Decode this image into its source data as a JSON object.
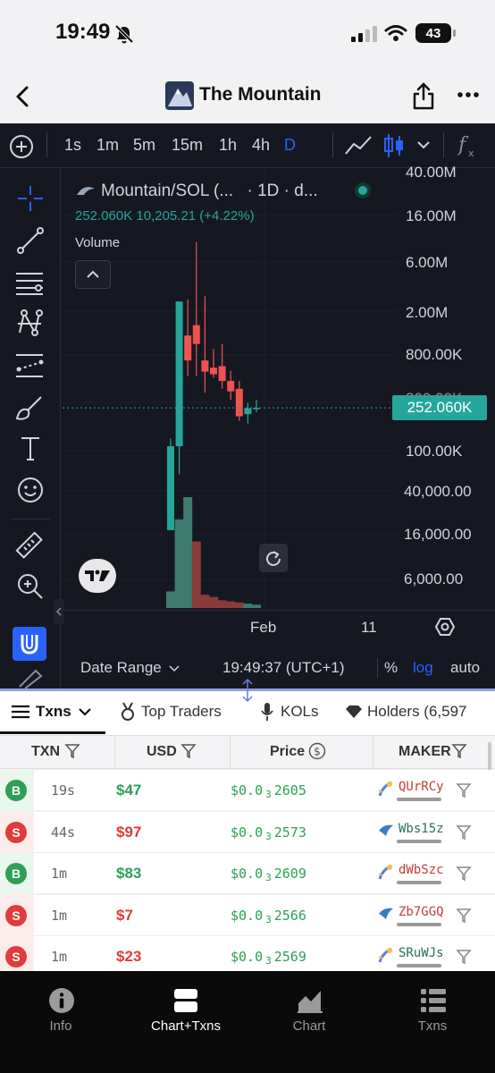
{
  "status_bar": {
    "time": "19:49",
    "battery": "43"
  },
  "header": {
    "title": "The Mountain"
  },
  "chart_toolbar": {
    "intervals": [
      "1s",
      "1m",
      "5m",
      "15m",
      "1h",
      "4h",
      "D"
    ],
    "active_interval": "D"
  },
  "chart_legend": {
    "symbol": "Mountain/SOL (...",
    "timeframe": "· 1D · d...",
    "values": "252.060K  10,205.21  (+4.22%)",
    "volume_label": "Volume"
  },
  "y_axis": {
    "labels": [
      "40.00M",
      "16.00M",
      "6.00M",
      "2.00M",
      "800.00K",
      "300.00K",
      "100.00K",
      "40,000.00",
      "16,000.00",
      "6,000.00"
    ],
    "current_price_tag": "252.060K"
  },
  "x_axis": {
    "labels": [
      "Feb",
      "11"
    ]
  },
  "chart_footer": {
    "date_range": "Date Range",
    "clock": "19:49:37 (UTC+1)",
    "percent": "%",
    "log": "log",
    "auto": "auto"
  },
  "chart_data": {
    "type": "candlestick",
    "series": [
      {
        "name": "Mountain/SOL",
        "candles": [
          {
            "o": 18000,
            "h": 130000,
            "l": 35000,
            "c": 110000
          },
          {
            "o": 110000,
            "h": 1300000,
            "l": 60000,
            "c": 2500000
          },
          {
            "o": 1200000,
            "h": 2600000,
            "l": 500000,
            "c": 700000
          },
          {
            "o": 1500000,
            "h": 9000000,
            "l": 500000,
            "c": 1000000
          },
          {
            "o": 700000,
            "h": 2800000,
            "l": 350000,
            "c": 550000
          },
          {
            "o": 600000,
            "h": 900000,
            "l": 480000,
            "c": 520000
          },
          {
            "o": 620000,
            "h": 1000000,
            "l": 380000,
            "c": 450000
          },
          {
            "o": 450000,
            "h": 560000,
            "l": 300000,
            "c": 360000
          },
          {
            "o": 380000,
            "h": 450000,
            "l": 190000,
            "c": 210000
          },
          {
            "o": 220000,
            "h": 280000,
            "l": 180000,
            "c": 250000
          },
          {
            "o": 250000,
            "h": 300000,
            "l": 230000,
            "c": 252060
          }
        ],
        "volume_colors": [
          "green",
          "green",
          "green",
          "red",
          "red",
          "red",
          "red",
          "red",
          "red",
          "green",
          "green"
        ]
      }
    ],
    "y_scale": "log",
    "current_price": 252060,
    "change": 10205.21,
    "change_pct": 4.22
  },
  "tabs": [
    {
      "label": "Txns"
    },
    {
      "label": "Top Traders"
    },
    {
      "label": "KOLs"
    },
    {
      "label": "Holders (6,597"
    }
  ],
  "table": {
    "headers": [
      "TXN",
      "USD",
      "Price",
      "MAKER"
    ],
    "rows": [
      {
        "type": "B",
        "age": "19s",
        "usd": "$47",
        "price_prefix": "$0.0",
        "price_sub": "3",
        "price_digits": "2605",
        "maker": "QUrRCy",
        "side": "buy"
      },
      {
        "type": "S",
        "age": "44s",
        "usd": "$97",
        "price_prefix": "$0.0",
        "price_sub": "3",
        "price_digits": "2573",
        "maker": "Wbs15z",
        "side": "sell"
      },
      {
        "type": "B",
        "age": "1m",
        "usd": "$83",
        "price_prefix": "$0.0",
        "price_sub": "3",
        "price_digits": "2609",
        "maker": "dWbSzc",
        "side": "buy"
      },
      {
        "type": "S",
        "age": "1m",
        "usd": "$7",
        "price_prefix": "$0.0",
        "price_sub": "3",
        "price_digits": "2566",
        "maker": "Zb7GGQ",
        "side": "sell"
      },
      {
        "type": "S",
        "age": "1m",
        "usd": "$23",
        "price_prefix": "$0.0",
        "price_sub": "3",
        "price_digits": "2569",
        "maker": "SRuWJs",
        "side": "sell"
      }
    ]
  },
  "bottom_nav": [
    {
      "label": "Info",
      "icon": "info-icon"
    },
    {
      "label": "Chart+Txns",
      "icon": "split-view-icon"
    },
    {
      "label": "Chart",
      "icon": "area-chart-icon"
    },
    {
      "label": "Txns",
      "icon": "list-icon"
    }
  ],
  "colors": {
    "up": "#26a69a",
    "down": "#ef5350",
    "accent": "#2962ff",
    "buy": "#2ea055",
    "sell": "#e03c3c"
  }
}
